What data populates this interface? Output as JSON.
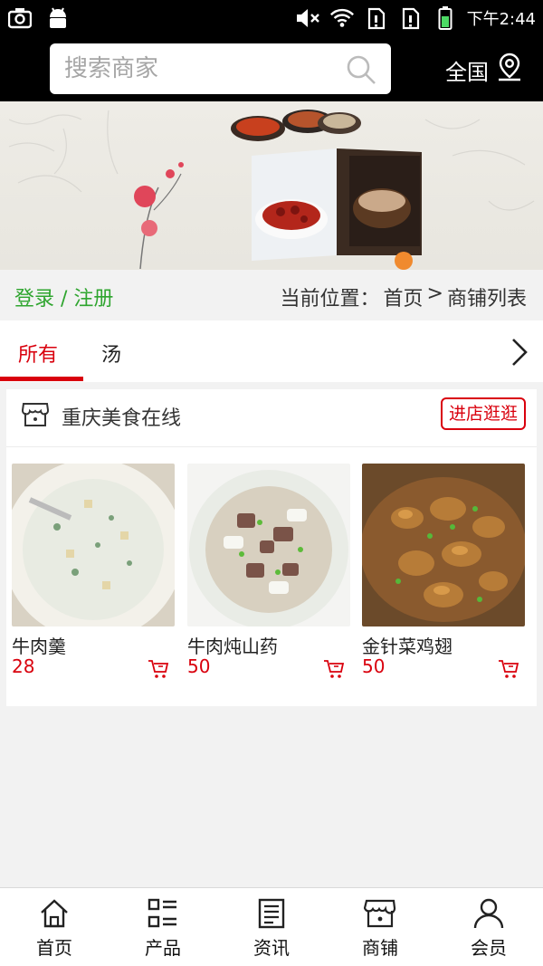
{
  "status_bar": {
    "time": "下午2:44",
    "left_icons": [
      "screenshot-icon",
      "android-icon"
    ],
    "right_icons": [
      "mute-icon",
      "wifi-icon",
      "sim1-icon",
      "sim2-icon",
      "battery-icon"
    ]
  },
  "header": {
    "search_placeholder": "搜索商家",
    "region_label": "全国"
  },
  "auth": {
    "login_register": "登录 / 注册"
  },
  "breadcrumb": {
    "prefix": "当前位置：",
    "home": "首页",
    "separator": ">",
    "current": "商铺列表"
  },
  "tabs": [
    {
      "label": "所有",
      "active": true
    },
    {
      "label": "汤",
      "active": false
    }
  ],
  "shop": {
    "name": "重庆美食在线",
    "visit_label": "进店逛逛",
    "products": [
      {
        "name": "牛肉羹",
        "price": "28"
      },
      {
        "name": "牛肉炖山药",
        "price": "50"
      },
      {
        "name": "金针菜鸡翅",
        "price": "50"
      }
    ]
  },
  "bottom_nav": [
    {
      "label": "首页",
      "icon": "home-icon"
    },
    {
      "label": "产品",
      "icon": "product-list-icon"
    },
    {
      "label": "资讯",
      "icon": "news-icon"
    },
    {
      "label": "商铺",
      "icon": "shop-icon"
    },
    {
      "label": "会员",
      "icon": "member-icon"
    }
  ],
  "colors": {
    "accent_red": "#d9000d",
    "login_green": "#2fa52f",
    "header_black": "#000000"
  }
}
